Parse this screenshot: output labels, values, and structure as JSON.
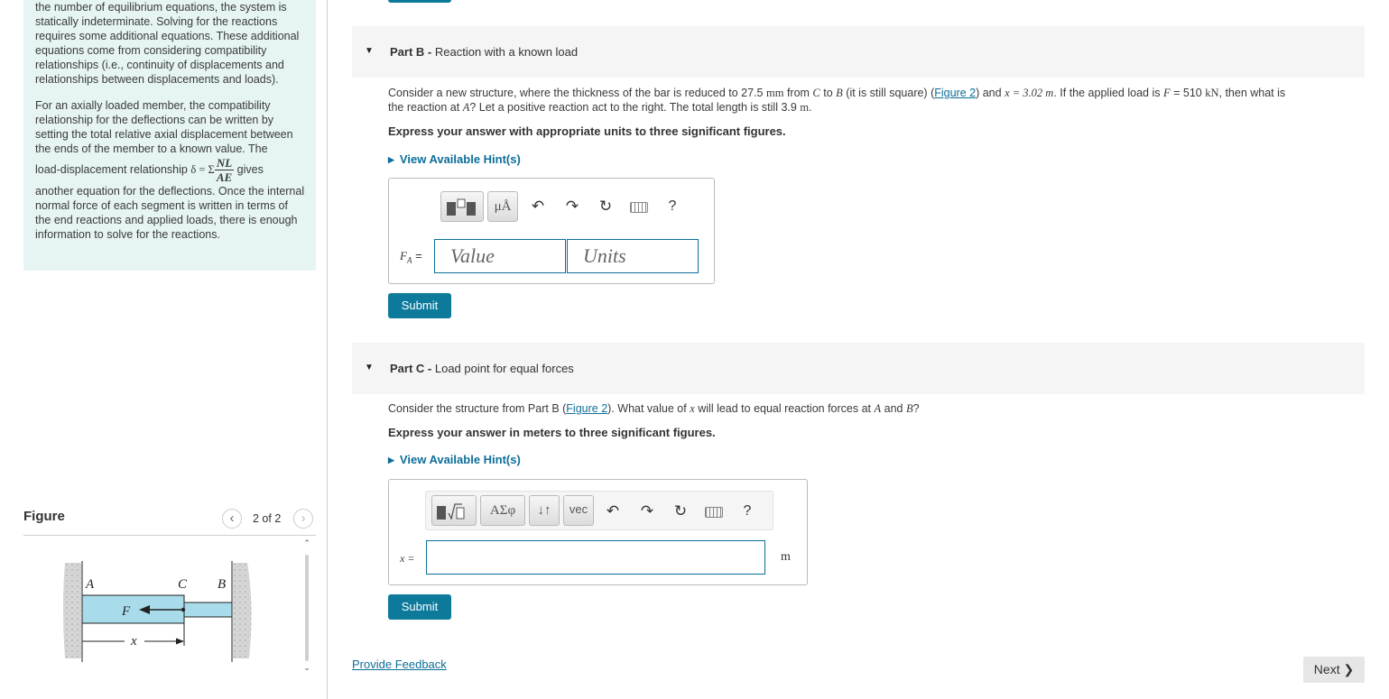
{
  "intro": {
    "p1": "the number of equilibrium equations, the system is statically indeterminate. Solving for the reactions requires some additional equations. These additional equations come from considering compatibility relationships (i.e., continuity of displacements and relationships between displacements and loads).",
    "p2": "For an axially loaded member, the compatibility relationship for the deflections can be written by setting the total relative axial displacement between the ends of the member to a known value. The",
    "p3_before": "load-displacement relationship",
    "p3_formula_lhs": "δ = Σ",
    "p3_formula_num": "NL",
    "p3_formula_den": "AE",
    "p3_after": "gives",
    "p4": "another equation for the deflections. Once the internal normal force of each segment is written in terms of the end reactions and applied loads, there is enough information to solve for the reactions."
  },
  "figure": {
    "title": "Figure",
    "counter": "2 of 2",
    "prev_icon": "chevron-left-icon",
    "next_icon": "chevron-right-icon",
    "labels": {
      "a": "A",
      "c": "C",
      "b": "B",
      "f": "F",
      "x": "x"
    }
  },
  "partB": {
    "title_bold": "Part B -",
    "title": "Reaction with a known load",
    "q1": "Consider a new structure, where the thickness of the bar is reduced to 27.5",
    "q_mm": "mm",
    "q2": "from",
    "q_c": "C",
    "q3": "to",
    "q_b": "B",
    "q4": "(it is still square) (",
    "fig_link": "Figure 2",
    "q5": ") and",
    "q_xeq": "x = 3.02 m",
    "q6": ". If the applied load is",
    "q_f": "F",
    "q7": "= 510",
    "q_kn": "kN",
    "q8": ", then what is",
    "line2_a": "the reaction at",
    "line2_A": "A",
    "line2_b": "? Let a positive reaction act to the right. The total length is still 3.9",
    "line2_m": "m",
    "line2_c": ".",
    "instruction": "Express your answer with appropriate units to three significant figures.",
    "hint": "View Available Hint(s)",
    "toolbar": {
      "units_btn": "μÅ",
      "help": "?"
    },
    "field_label": "F",
    "field_sub": "A",
    "field_eq": "=",
    "value_placeholder": "Value",
    "units_placeholder": "Units",
    "submit": "Submit"
  },
  "partC": {
    "title_bold": "Part C -",
    "title": "Load point for equal forces",
    "q1": "Consider the structure from Part B (",
    "fig_link": "Figure 2",
    "q2": "). What value of",
    "q_x": "x",
    "q3": "will lead to equal reaction forces at",
    "q_A": "A",
    "q4": "and",
    "q_B": "B",
    "q5": "?",
    "instruction": "Express your answer in meters to three significant figures.",
    "hint": "View Available Hint(s)",
    "toolbar": {
      "greek_btn": "ΑΣφ",
      "arrows_btn": "↓↑",
      "vec_btn": "vec",
      "help": "?"
    },
    "field_label": "x =",
    "unit": "m",
    "submit": "Submit"
  },
  "footer": {
    "feedback": "Provide Feedback",
    "next": "Next ❯"
  }
}
